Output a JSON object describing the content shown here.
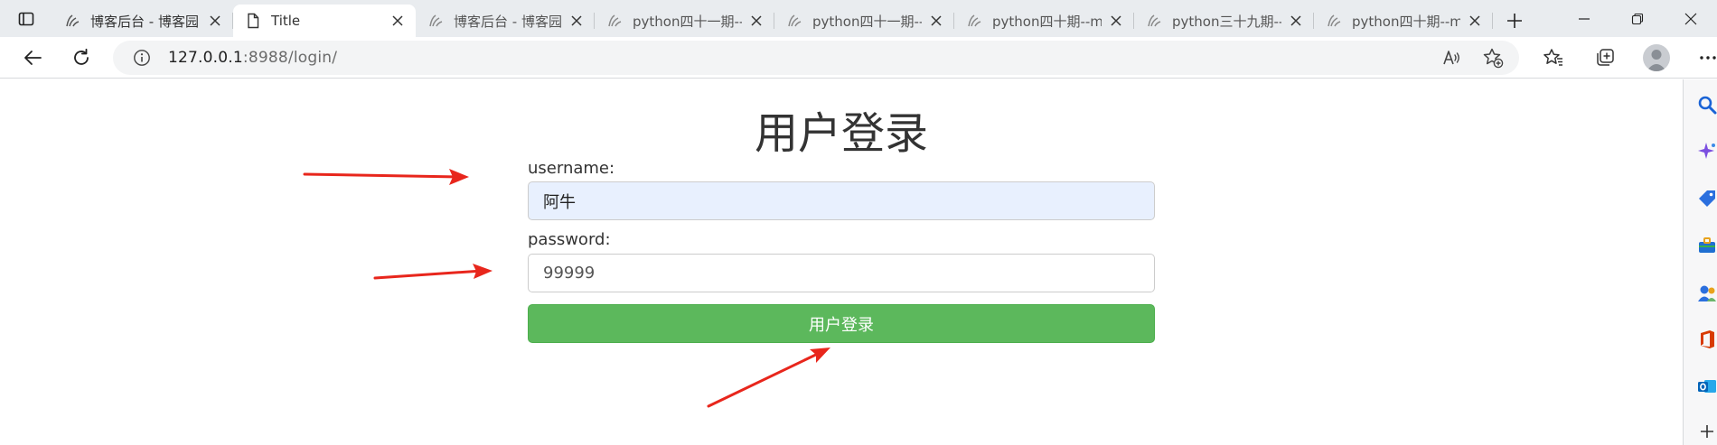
{
  "browser": {
    "tabs": [
      {
        "label": "博客后台 - 博客园",
        "icon": "cnblogs-icon",
        "active": false
      },
      {
        "label": "Title",
        "icon": "page-icon",
        "active": true
      },
      {
        "label": "博客后台 - 博客园",
        "icon": "cnblogs-icon",
        "active": false
      },
      {
        "label": "python四十一期--",
        "icon": "cnblogs-icon",
        "active": false
      },
      {
        "label": "python四十一期--",
        "icon": "cnblogs-icon",
        "active": false
      },
      {
        "label": "python四十期--m",
        "icon": "cnblogs-icon",
        "active": false
      },
      {
        "label": "python三十九期--",
        "icon": "cnblogs-icon",
        "active": false
      },
      {
        "label": "python四十期--m",
        "icon": "cnblogs-icon",
        "active": false
      }
    ],
    "address": {
      "host": "127.0.0.1",
      "path": ":8988/login/"
    },
    "toolbar_icons": [
      "read-aloud-icon",
      "add-favorite-icon",
      "favorites-icon",
      "collections-icon",
      "profile-avatar",
      "more-icon"
    ],
    "side_icons": [
      "search-icon",
      "copilot-icon",
      "shopping-icon",
      "tools-icon",
      "games-icon",
      "office-icon",
      "outlook-icon",
      "add-icon"
    ]
  },
  "login": {
    "title": "用户登录",
    "username_label": "username:",
    "username_value": "阿牛",
    "password_label": "password:",
    "password_value": "99999",
    "submit_label": "用户登录"
  },
  "colors": {
    "submit_bg": "#5cb85c",
    "autofill_bg": "#e8f0fe",
    "arrow": "#e8261c"
  }
}
